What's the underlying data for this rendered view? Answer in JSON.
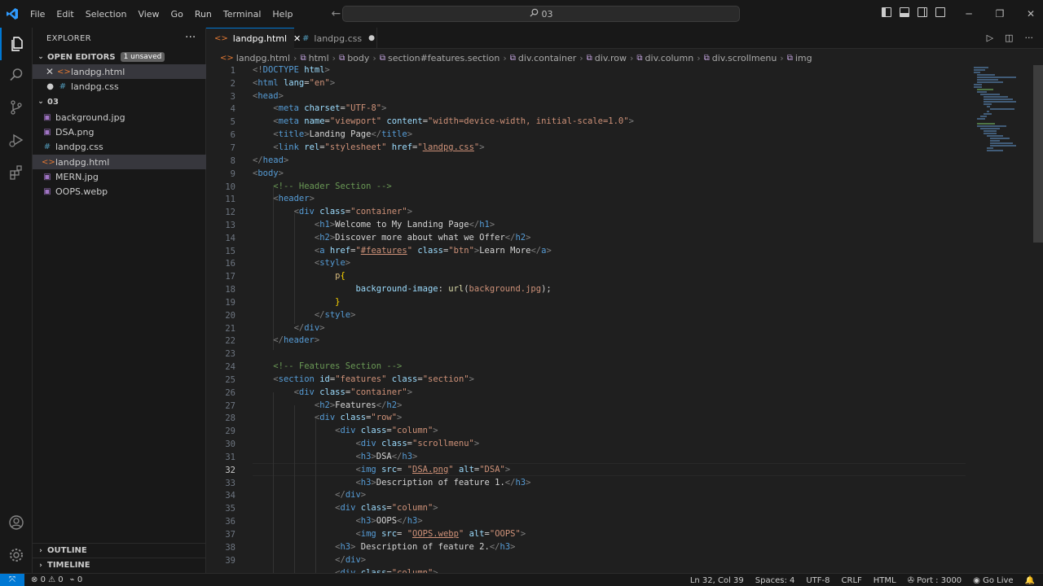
{
  "titlebar": {
    "menu": [
      "File",
      "Edit",
      "Selection",
      "View",
      "Go",
      "Run",
      "Terminal",
      "Help"
    ],
    "search": "03"
  },
  "explorer": {
    "title": "EXPLORER",
    "open_editors_label": "OPEN EDITORS",
    "unsaved_badge": "1 unsaved",
    "open_editors": [
      {
        "name": "landpg.html",
        "type": "html"
      },
      {
        "name": "landpg.css",
        "type": "css"
      }
    ],
    "folder_name": "03",
    "files": [
      {
        "name": "background.jpg",
        "type": "image"
      },
      {
        "name": "DSA.png",
        "type": "image"
      },
      {
        "name": "landpg.css",
        "type": "css"
      },
      {
        "name": "landpg.html",
        "type": "html"
      },
      {
        "name": "MERN.jpg",
        "type": "image"
      },
      {
        "name": "OOPS.webp",
        "type": "image"
      }
    ],
    "outline_label": "OUTLINE",
    "timeline_label": "TIMELINE"
  },
  "tabs": [
    {
      "label": "landpg.html",
      "active": true
    },
    {
      "label": "landpg.css",
      "active": false,
      "dirty": true
    }
  ],
  "breadcrumb": [
    "landpg.html",
    "html",
    "body",
    "section#features.section",
    "div.container",
    "div.row",
    "div.column",
    "div.scrollmenu",
    "img"
  ],
  "editor": {
    "current_line": 32,
    "line_numbers": [
      "1",
      "2",
      "3",
      "4",
      "5",
      "6",
      "7",
      "8",
      "9",
      "10",
      "11",
      "12",
      "13",
      "14",
      "15",
      "16",
      "17",
      "18",
      "19",
      "20",
      "21",
      "22",
      "23",
      "24",
      "25",
      "26",
      "27",
      "28",
      "29",
      "30",
      "31",
      "32",
      "33",
      "34",
      "35",
      "36",
      "37",
      "38",
      "39"
    ]
  },
  "statusbar": {
    "errors": "0",
    "warnings": "0",
    "ports": "0",
    "cursor": "Ln 32, Col 39",
    "spaces": "Spaces: 4",
    "encoding": "UTF-8",
    "eol": "CRLF",
    "language": "HTML",
    "port": "Port : 3000",
    "golive": "Go Live"
  },
  "colors": {
    "accent": "#0078d4",
    "tag": "#569cd6",
    "attribute": "#9cdcfe",
    "string": "#ce9178",
    "comment": "#6a9955"
  }
}
